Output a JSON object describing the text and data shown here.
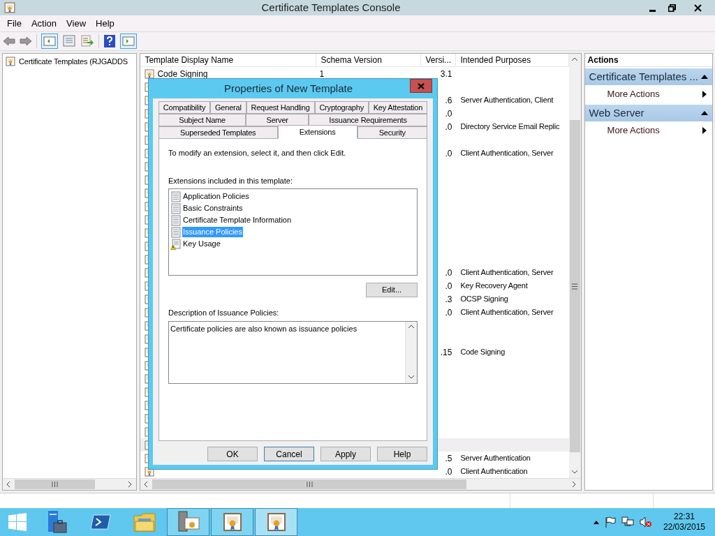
{
  "window": {
    "title": "Certificate Templates Console"
  },
  "menu": [
    "File",
    "Action",
    "View",
    "Help"
  ],
  "tree": {
    "items": [
      {
        "label": "Certificate Templates (RJGADDS"
      }
    ]
  },
  "table": {
    "columns": [
      "Template Display Name",
      "Schema Version",
      "Versi...",
      "Intended Purposes"
    ],
    "rows": [
      {
        "name": "Code Signing",
        "schema": "1",
        "version": "3.1",
        "selected": false
      },
      {
        "selected": false
      },
      {
        "version": ".6",
        "purposes": "Server Authentication, Client",
        "selected": false
      },
      {
        "version": ".0",
        "selected": false
      },
      {
        "version": ".0",
        "purposes": "Directory Service Email Replic",
        "selected": false
      },
      {
        "selected": false
      },
      {
        "version": ".0",
        "purposes": "Client Authentication, Server",
        "selected": false
      },
      {
        "selected": false
      },
      {
        "selected": false
      },
      {
        "selected": false
      },
      {
        "selected": false
      },
      {
        "selected": false
      },
      {
        "selected": false
      },
      {
        "selected": false
      },
      {
        "selected": false
      },
      {
        "version": ".0",
        "purposes": "Client Authentication, Server",
        "selected": false
      },
      {
        "version": ".0",
        "purposes": "Key Recovery Agent",
        "selected": false
      },
      {
        "version": ".3",
        "purposes": "OCSP Signing",
        "selected": false
      },
      {
        "version": ".0",
        "purposes": "Client Authentication, Server",
        "selected": false
      },
      {
        "selected": false
      },
      {
        "selected": false
      },
      {
        "version": ".15",
        "purposes": "Code Signing",
        "selected": false
      },
      {
        "selected": false
      },
      {
        "selected": false
      },
      {
        "selected": false
      },
      {
        "selected": false
      },
      {
        "selected": false
      },
      {
        "selected": false
      },
      {
        "selected": true
      },
      {
        "version": ".5",
        "purposes": "Server Authentication",
        "selected": false
      },
      {
        "version": ".0",
        "purposes": "Client Authentication",
        "selected": false
      }
    ]
  },
  "actions": {
    "title": "Actions",
    "groups": [
      {
        "title": "Certificate Templates ...",
        "items": [
          "More Actions"
        ]
      },
      {
        "title": "Web Server",
        "items": [
          "More Actions"
        ]
      }
    ]
  },
  "dialog": {
    "title": "Properties of New Template",
    "tab_rows": [
      [
        {
          "label": "Compatibility",
          "selected": false
        },
        {
          "label": "General",
          "selected": false
        },
        {
          "label": "Request Handling",
          "selected": false
        },
        {
          "label": "Cryptography",
          "selected": false
        },
        {
          "label": "Key Attestation",
          "selected": false
        }
      ],
      [
        {
          "label": "Subject Name",
          "selected": false
        },
        {
          "label": "Server",
          "selected": false
        },
        {
          "label": "Issuance Requirements",
          "selected": false
        }
      ],
      [
        {
          "label": "Superseded Templates",
          "selected": false
        },
        {
          "label": "Extensions",
          "selected": true
        },
        {
          "label": "Security",
          "selected": false
        }
      ]
    ],
    "instruction": "To modify an extension, select it, and then click Edit.",
    "list_label": "Extensions included in this template:",
    "extensions": [
      {
        "label": "Application Policies",
        "kind": "normal",
        "selected": false
      },
      {
        "label": "Basic Constraints",
        "kind": "normal",
        "selected": false
      },
      {
        "label": "Certificate Template Information",
        "kind": "normal",
        "selected": false
      },
      {
        "label": "Issuance Policies",
        "kind": "normal",
        "selected": true
      },
      {
        "label": "Key Usage",
        "kind": "warning",
        "selected": false
      }
    ],
    "edit_button": "Edit...",
    "description_label": "Description of Issuance Policies:",
    "description": "Certificate policies are also known as issuance policies",
    "buttons": [
      {
        "label": "OK",
        "focused": false
      },
      {
        "label": "Cancel",
        "focused": true
      },
      {
        "label": "Apply",
        "focused": false
      },
      {
        "label": "Help",
        "focused": false
      }
    ]
  },
  "taskbar": {
    "apps": [
      {
        "kind": "server-manager",
        "open": false,
        "active": false
      },
      {
        "kind": "powershell",
        "open": false,
        "active": false
      },
      {
        "kind": "explorer",
        "open": false,
        "active": false
      },
      {
        "kind": "certificate-authority",
        "open": true,
        "active": false
      },
      {
        "kind": "certificate-template",
        "open": true,
        "active": false
      },
      {
        "kind": "certificate-template",
        "open": true,
        "active": true
      }
    ],
    "clock": {
      "time": "22:31",
      "date": "22/03/2015"
    }
  }
}
